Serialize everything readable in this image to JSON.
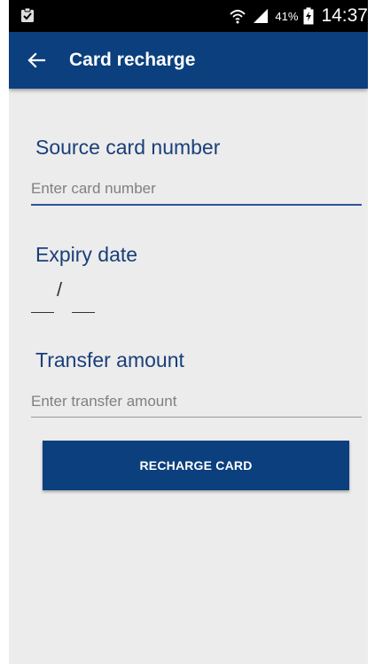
{
  "status_bar": {
    "battery_percent": "41%",
    "time": "14:37",
    "icons": [
      "clipboard-check-icon",
      "wifi-icon",
      "cellular-signal-icon",
      "battery-charging-icon"
    ]
  },
  "app_bar": {
    "title": "Card recharge",
    "back_icon": "arrow-left-icon"
  },
  "form": {
    "source_card": {
      "label": "Source card number",
      "placeholder": "Enter card number",
      "value": ""
    },
    "expiry": {
      "label": "Expiry date",
      "separator": "/",
      "month": "",
      "year": ""
    },
    "amount": {
      "label": "Transfer amount",
      "placeholder": "Enter transfer amount",
      "value": ""
    },
    "submit_label": "RECHARGE CARD"
  },
  "colors": {
    "primary": "#0b3f7e",
    "label": "#1a3f7a",
    "background": "#ececec",
    "status_bar": "#000000"
  }
}
